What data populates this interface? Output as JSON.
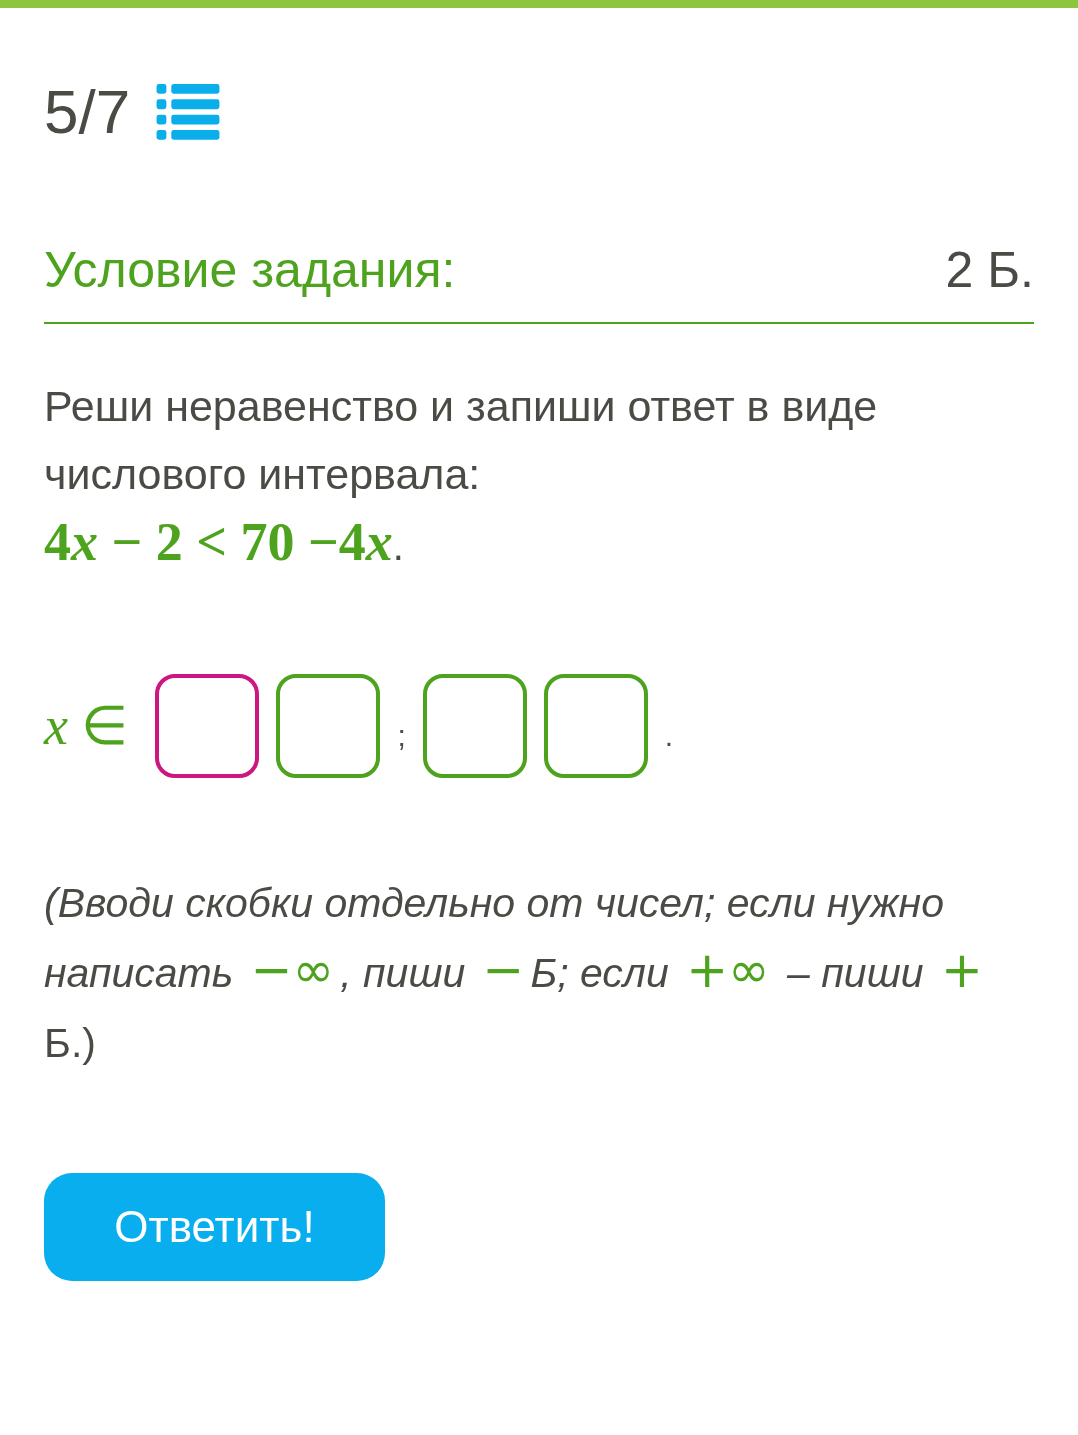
{
  "header": {
    "progress": "5/7"
  },
  "task": {
    "title": "Условие задания:",
    "points": "2 Б."
  },
  "instruction": "Реши неравенство и запиши ответ в виде числового интервала:",
  "formula": [
    {
      "kind": "upright",
      "text": "4"
    },
    {
      "kind": "variable",
      "text": "x"
    },
    {
      "kind": "upright",
      "text": " − 2 < 70 −4"
    },
    {
      "kind": "variable",
      "text": "x"
    },
    {
      "kind": "punctuation",
      "text": "."
    }
  ],
  "answer": {
    "label": "*x* ∈",
    "parts": [
      {
        "kind": "field",
        "focused": true
      },
      {
        "kind": "field",
        "focused": false
      },
      {
        "kind": "separator",
        "text": ";"
      },
      {
        "kind": "field",
        "focused": false
      },
      {
        "kind": "field",
        "focused": false
      },
      {
        "kind": "separator",
        "text": "."
      }
    ]
  },
  "hint": [
    {
      "kind": "text",
      "text": "(Вводи скобки отдельно от чисел; если нужно написать "
    },
    {
      "kind": "math",
      "text": "−∞"
    },
    {
      "kind": "text",
      "text": ", пиши  "
    },
    {
      "kind": "math",
      "text": "−"
    },
    {
      "kind": "text",
      "text": "Б; если "
    },
    {
      "kind": "math",
      "text": "+∞"
    },
    {
      "kind": "text",
      "text": " – пиши  "
    },
    {
      "kind": "math",
      "text": "+"
    },
    {
      "kind": "upright",
      "text": "Б.)"
    }
  ],
  "submit_button": "Ответить!"
}
